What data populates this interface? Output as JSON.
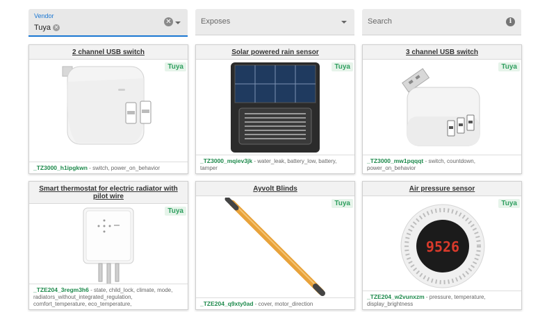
{
  "filters": {
    "vendor_label": "Vendor",
    "vendor_chip": "Tuya",
    "exposes_placeholder": "Exposes",
    "search_placeholder": "Search"
  },
  "devices": [
    {
      "title": "2 channel USB switch",
      "vendor": "Tuya",
      "model": "_TZ3000_h1ipgkwn",
      "exposes": "switch, power_on_behavior"
    },
    {
      "title": "Solar powered rain sensor",
      "vendor": "Tuya",
      "model": "_TZ3000_mqiev3jk",
      "exposes": "water_leak, battery_low, battery, tamper"
    },
    {
      "title": "3 channel USB switch",
      "vendor": "Tuya",
      "model": "_TZ3000_mw1pqqqt",
      "exposes": "switch, countdown, power_on_behavior"
    },
    {
      "title": "Smart thermostat for electric radiator with pilot wire",
      "vendor": "Tuya",
      "model": "_TZE204_3regm3h6",
      "exposes": "state, child_lock, climate, mode, radiators_without_integrated_regulation, comfort_temperature, eco_temperature,"
    },
    {
      "title": "Ayvolt Blinds",
      "vendor": "Tuya",
      "model": "_TZE204_q9xty0ad",
      "exposes": "cover, motor_direction"
    },
    {
      "title": "Air pressure sensor",
      "vendor": "Tuya",
      "model": "_TZE204_w2vunxzm",
      "exposes": "pressure, temperature, display_brightness"
    }
  ],
  "exposes_separator": " - ",
  "sensor_display": "9526",
  "icons": {
    "clear": "clear-icon",
    "dropdown": "chevron-down-icon",
    "info": "info-icon",
    "chip_delete": "cancel-icon"
  },
  "colors": {
    "accent": "#1976d2",
    "vendor_badge_text": "#2e9e5e",
    "model_text": "#1e8a4c",
    "blind_tube": "#e8a23a"
  }
}
